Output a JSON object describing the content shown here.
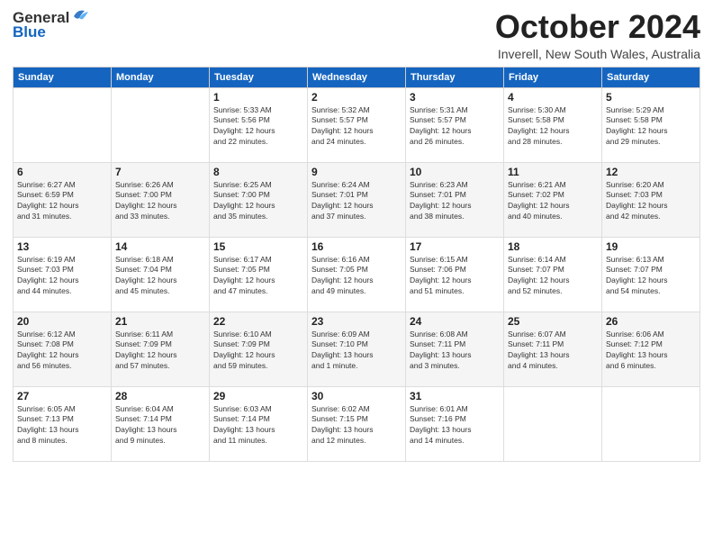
{
  "header": {
    "logo_general": "General",
    "logo_blue": "Blue",
    "month": "October 2024",
    "location": "Inverell, New South Wales, Australia"
  },
  "weekdays": [
    "Sunday",
    "Monday",
    "Tuesday",
    "Wednesday",
    "Thursday",
    "Friday",
    "Saturday"
  ],
  "weeks": [
    [
      {
        "day": "",
        "info": ""
      },
      {
        "day": "",
        "info": ""
      },
      {
        "day": "1",
        "info": "Sunrise: 5:33 AM\nSunset: 5:56 PM\nDaylight: 12 hours\nand 22 minutes."
      },
      {
        "day": "2",
        "info": "Sunrise: 5:32 AM\nSunset: 5:57 PM\nDaylight: 12 hours\nand 24 minutes."
      },
      {
        "day": "3",
        "info": "Sunrise: 5:31 AM\nSunset: 5:57 PM\nDaylight: 12 hours\nand 26 minutes."
      },
      {
        "day": "4",
        "info": "Sunrise: 5:30 AM\nSunset: 5:58 PM\nDaylight: 12 hours\nand 28 minutes."
      },
      {
        "day": "5",
        "info": "Sunrise: 5:29 AM\nSunset: 5:58 PM\nDaylight: 12 hours\nand 29 minutes."
      }
    ],
    [
      {
        "day": "6",
        "info": "Sunrise: 6:27 AM\nSunset: 6:59 PM\nDaylight: 12 hours\nand 31 minutes."
      },
      {
        "day": "7",
        "info": "Sunrise: 6:26 AM\nSunset: 7:00 PM\nDaylight: 12 hours\nand 33 minutes."
      },
      {
        "day": "8",
        "info": "Sunrise: 6:25 AM\nSunset: 7:00 PM\nDaylight: 12 hours\nand 35 minutes."
      },
      {
        "day": "9",
        "info": "Sunrise: 6:24 AM\nSunset: 7:01 PM\nDaylight: 12 hours\nand 37 minutes."
      },
      {
        "day": "10",
        "info": "Sunrise: 6:23 AM\nSunset: 7:01 PM\nDaylight: 12 hours\nand 38 minutes."
      },
      {
        "day": "11",
        "info": "Sunrise: 6:21 AM\nSunset: 7:02 PM\nDaylight: 12 hours\nand 40 minutes."
      },
      {
        "day": "12",
        "info": "Sunrise: 6:20 AM\nSunset: 7:03 PM\nDaylight: 12 hours\nand 42 minutes."
      }
    ],
    [
      {
        "day": "13",
        "info": "Sunrise: 6:19 AM\nSunset: 7:03 PM\nDaylight: 12 hours\nand 44 minutes."
      },
      {
        "day": "14",
        "info": "Sunrise: 6:18 AM\nSunset: 7:04 PM\nDaylight: 12 hours\nand 45 minutes."
      },
      {
        "day": "15",
        "info": "Sunrise: 6:17 AM\nSunset: 7:05 PM\nDaylight: 12 hours\nand 47 minutes."
      },
      {
        "day": "16",
        "info": "Sunrise: 6:16 AM\nSunset: 7:05 PM\nDaylight: 12 hours\nand 49 minutes."
      },
      {
        "day": "17",
        "info": "Sunrise: 6:15 AM\nSunset: 7:06 PM\nDaylight: 12 hours\nand 51 minutes."
      },
      {
        "day": "18",
        "info": "Sunrise: 6:14 AM\nSunset: 7:07 PM\nDaylight: 12 hours\nand 52 minutes."
      },
      {
        "day": "19",
        "info": "Sunrise: 6:13 AM\nSunset: 7:07 PM\nDaylight: 12 hours\nand 54 minutes."
      }
    ],
    [
      {
        "day": "20",
        "info": "Sunrise: 6:12 AM\nSunset: 7:08 PM\nDaylight: 12 hours\nand 56 minutes."
      },
      {
        "day": "21",
        "info": "Sunrise: 6:11 AM\nSunset: 7:09 PM\nDaylight: 12 hours\nand 57 minutes."
      },
      {
        "day": "22",
        "info": "Sunrise: 6:10 AM\nSunset: 7:09 PM\nDaylight: 12 hours\nand 59 minutes."
      },
      {
        "day": "23",
        "info": "Sunrise: 6:09 AM\nSunset: 7:10 PM\nDaylight: 13 hours\nand 1 minute."
      },
      {
        "day": "24",
        "info": "Sunrise: 6:08 AM\nSunset: 7:11 PM\nDaylight: 13 hours\nand 3 minutes."
      },
      {
        "day": "25",
        "info": "Sunrise: 6:07 AM\nSunset: 7:11 PM\nDaylight: 13 hours\nand 4 minutes."
      },
      {
        "day": "26",
        "info": "Sunrise: 6:06 AM\nSunset: 7:12 PM\nDaylight: 13 hours\nand 6 minutes."
      }
    ],
    [
      {
        "day": "27",
        "info": "Sunrise: 6:05 AM\nSunset: 7:13 PM\nDaylight: 13 hours\nand 8 minutes."
      },
      {
        "day": "28",
        "info": "Sunrise: 6:04 AM\nSunset: 7:14 PM\nDaylight: 13 hours\nand 9 minutes."
      },
      {
        "day": "29",
        "info": "Sunrise: 6:03 AM\nSunset: 7:14 PM\nDaylight: 13 hours\nand 11 minutes."
      },
      {
        "day": "30",
        "info": "Sunrise: 6:02 AM\nSunset: 7:15 PM\nDaylight: 13 hours\nand 12 minutes."
      },
      {
        "day": "31",
        "info": "Sunrise: 6:01 AM\nSunset: 7:16 PM\nDaylight: 13 hours\nand 14 minutes."
      },
      {
        "day": "",
        "info": ""
      },
      {
        "day": "",
        "info": ""
      }
    ]
  ]
}
